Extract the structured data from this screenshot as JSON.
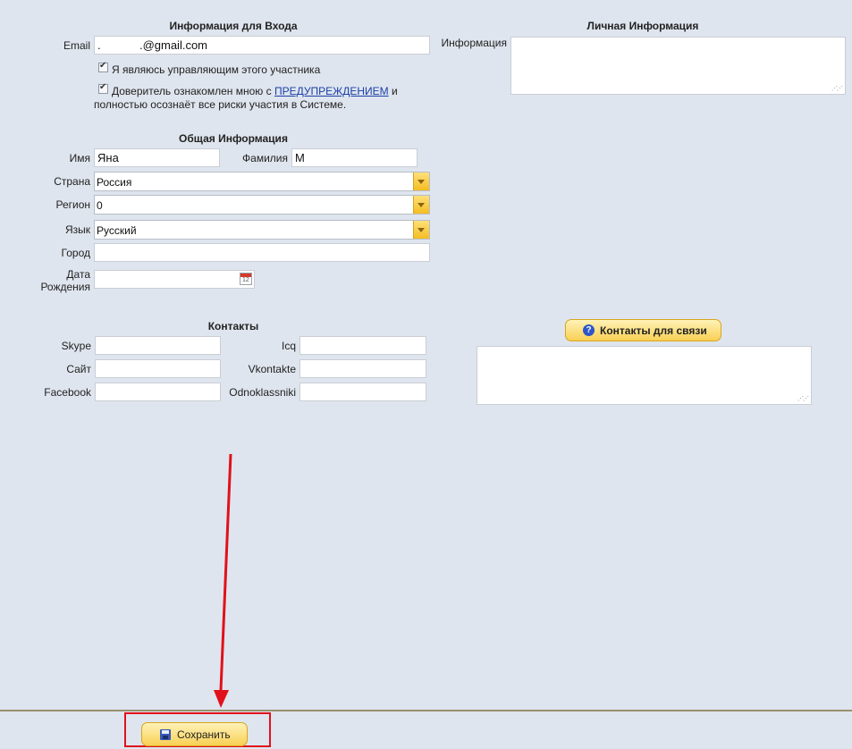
{
  "login": {
    "title": "Информация для Входа",
    "email_label": "Email",
    "email_value": ".            .@gmail.com",
    "checkbox_manager": "Я являюсь управляющим этого участника",
    "checkbox_trustee_pre": "Доверитель ознакомлен мною с ",
    "checkbox_trustee_link": "ПРЕДУПРЕЖДЕНИЕМ",
    "checkbox_trustee_post": " и",
    "checkbox_trustee_line2": "полностью осознаёт все риски участия в Системе."
  },
  "personal": {
    "title": "Личная Информация",
    "info_label": "Информация",
    "info_value": ""
  },
  "general": {
    "title": "Общая Информация",
    "first_name_label": "Имя",
    "first_name_value": "Яна",
    "last_name_label": "Фамилия",
    "last_name_value": "М",
    "country_label": "Страна",
    "country_value": "Россия",
    "region_label": "Регион",
    "region_value": "0",
    "language_label": "Язык",
    "language_value": "Русский",
    "city_label": "Город",
    "city_value": "",
    "birth_label_line1": "Дата",
    "birth_label_line2": "Рождения",
    "birth_value": ""
  },
  "contacts": {
    "title": "Контакты",
    "skype_label": "Skype",
    "icq_label": "Icq",
    "site_label": "Сайт",
    "vkontakte_label": "Vkontakte",
    "facebook_label": "Facebook",
    "odnoklassniki_label": "Odnoklassniki",
    "contact_button": "Контакты для связи",
    "contact_button_icon": "?"
  },
  "footer": {
    "save_button": "Сохранить"
  },
  "colors": {
    "background": "#dfe5ee",
    "annotation": "#e0111a",
    "button_gold": "#f8d054",
    "link": "#1a3fa8"
  }
}
